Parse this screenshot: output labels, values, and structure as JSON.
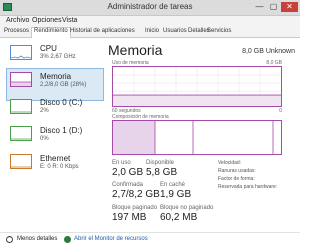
{
  "window": {
    "title": "Administrador de tareas",
    "controls": {
      "minimize": "—",
      "maximize": "▢",
      "close": "✕"
    }
  },
  "menu": [
    "Archivo",
    "Opciones",
    "Vista"
  ],
  "tabs": [
    "Procesos",
    "Rendimiento",
    "Historial de aplicaciones",
    "Inicio",
    "Usuarios",
    "Detalles",
    "Servicios"
  ],
  "active_tab": "Rendimiento",
  "sidebar": [
    {
      "name": "CPU",
      "value": "3% 2,67 GHz",
      "color": "#4f8fd1"
    },
    {
      "name": "Memoria",
      "value": "2,2/8,0 GB (28%)",
      "color": "#a44aa8"
    },
    {
      "name": "Disco 0 (C:)",
      "value": "2%",
      "color": "#4aa04a"
    },
    {
      "name": "Disco 1 (D:)",
      "value": "0%",
      "color": "#4aa04a"
    },
    {
      "name": "Ethernet",
      "value": "E: 0 R: 0 Kbps",
      "color": "#c77a2b"
    }
  ],
  "main": {
    "title": "Memoria",
    "total": "8,0 GB Unknown",
    "usage_label": "Uso de memoria",
    "usage_max": "8,0 GB",
    "time_left": "60 segundos",
    "time_right": "0",
    "composition_label": "Composición de memoria",
    "usage_fraction": 0.28
  },
  "stats": {
    "en_uso": {
      "label": "En uso",
      "value": "2,0 GB"
    },
    "disponible": {
      "label": "Disponible",
      "value": "5,8 GB"
    },
    "confirmada": {
      "label": "Confirmada",
      "value": "2,7/8,2 GB"
    },
    "en_cache": {
      "label": "En caché",
      "value": "1,9 GB"
    },
    "bloque_paginado": {
      "label": "Bloque paginado",
      "value": "197 MB"
    },
    "bloque_no_paginado": {
      "label": "Bloque no paginado",
      "value": "60,2 MB"
    }
  },
  "right_labels": [
    "Velocidad:",
    "Ranuras usadas:",
    "Factor de forma:",
    "Reservada para hardware:"
  ],
  "footer": {
    "less_details": "Menos detalles",
    "open_monitor": "Abrir el Monitor de recursos"
  }
}
